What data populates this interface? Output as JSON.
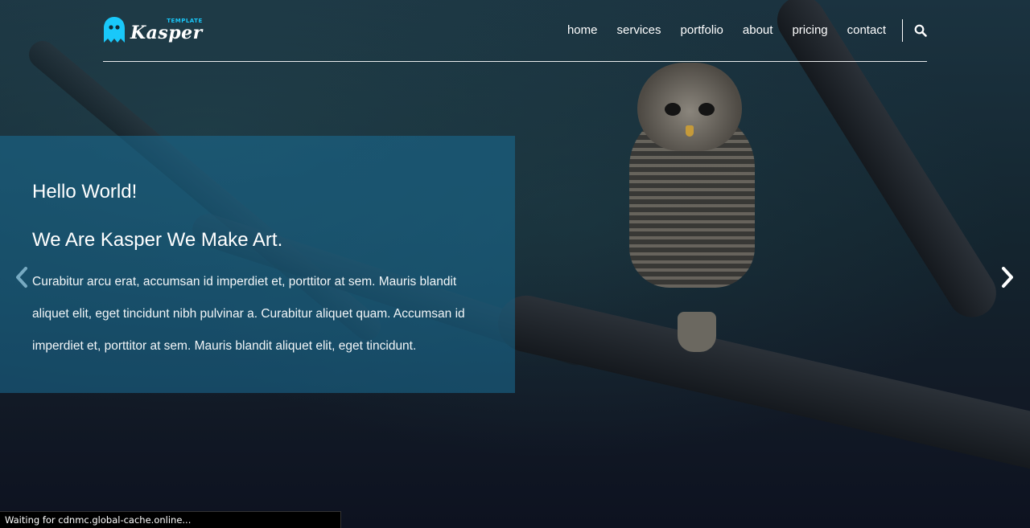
{
  "brand": {
    "name": "Kasper",
    "tagline": "TEMPLATE",
    "accent_color": "#19c8fa",
    "logo_icon": "ghost-icon"
  },
  "nav": {
    "items": [
      {
        "label": "home"
      },
      {
        "label": "services"
      },
      {
        "label": "portfolio"
      },
      {
        "label": "about"
      },
      {
        "label": "pricing"
      },
      {
        "label": "contact"
      }
    ],
    "search_icon": "search-icon"
  },
  "hero": {
    "greeting": "Hello World!",
    "headline": "We Are Kasper We Make Art.",
    "body": "Curabitur arcu erat, accumsan id imperdiet et, porttitor at sem. Mauris blandit aliquet elit, eget tincidunt nibh pulvinar a. Curabitur aliquet quam. Accumsan id imperdiet et, porttitor at sem. Mauris blandit aliquet elit, eget tincidunt.",
    "box_color": "#1a6e96",
    "prev_icon": "chevron-left-icon",
    "next_icon": "chevron-right-icon"
  },
  "status_bar": {
    "text": "Waiting for cdnmc.global-cache.online..."
  }
}
